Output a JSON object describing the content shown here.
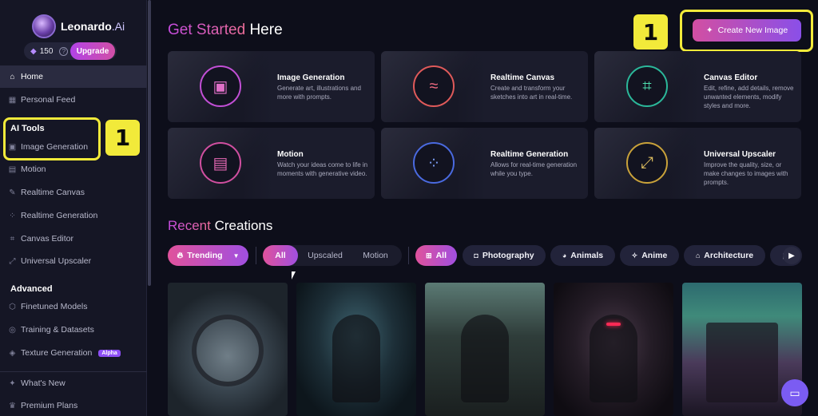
{
  "brand": {
    "name": "Leonardo",
    "suffix": ".Ai"
  },
  "credits": {
    "amount": "150",
    "upgrade_label": "Upgrade"
  },
  "sidebar": {
    "home": "Home",
    "personal_feed": "Personal Feed",
    "ai_tools_heading": "AI Tools",
    "tools": [
      "Image Generation",
      "Motion",
      "Realtime Canvas",
      "Realtime Generation",
      "Canvas Editor",
      "Universal Upscaler"
    ],
    "advanced_heading": "Advanced",
    "advanced": [
      "Finetuned Models",
      "Training & Datasets",
      "Texture Generation"
    ],
    "alpha_badge": "Alpha",
    "footer": [
      "What's New",
      "Premium Plans"
    ]
  },
  "annotations": {
    "marker_1": "1",
    "marker_2": "1"
  },
  "header": {
    "title_accent": "Get Started",
    "title_rest": " Here",
    "create_button": "Create New Image"
  },
  "cards": [
    {
      "title": "Image Generation",
      "desc": "Generate art, illustrations and more with prompts."
    },
    {
      "title": "Realtime Canvas",
      "desc": "Create and transform your sketches into art in real-time."
    },
    {
      "title": "Canvas Editor",
      "desc": "Edit, refine, add details, remove unwanted elements, modify styles and more."
    },
    {
      "title": "Motion",
      "desc": "Watch your ideas come to life in moments with generative video."
    },
    {
      "title": "Realtime Generation",
      "desc": "Allows for real-time generation while you type."
    },
    {
      "title": "Universal Upscaler",
      "desc": "Improve the quality, size, or make changes to images with prompts."
    }
  ],
  "recent": {
    "title_accent": "Recent",
    "title_rest": " Creations",
    "sort": "Trending",
    "type_filters": [
      "All",
      "Upscaled",
      "Motion"
    ],
    "categories": [
      "All",
      "Photography",
      "Animals",
      "Anime",
      "Architecture"
    ]
  },
  "colors": {
    "accent_pink": "#d24fa2",
    "accent_purple": "#8a4fe8",
    "highlight_yellow": "#f2ea3a",
    "bg": "#0d0e1a"
  }
}
